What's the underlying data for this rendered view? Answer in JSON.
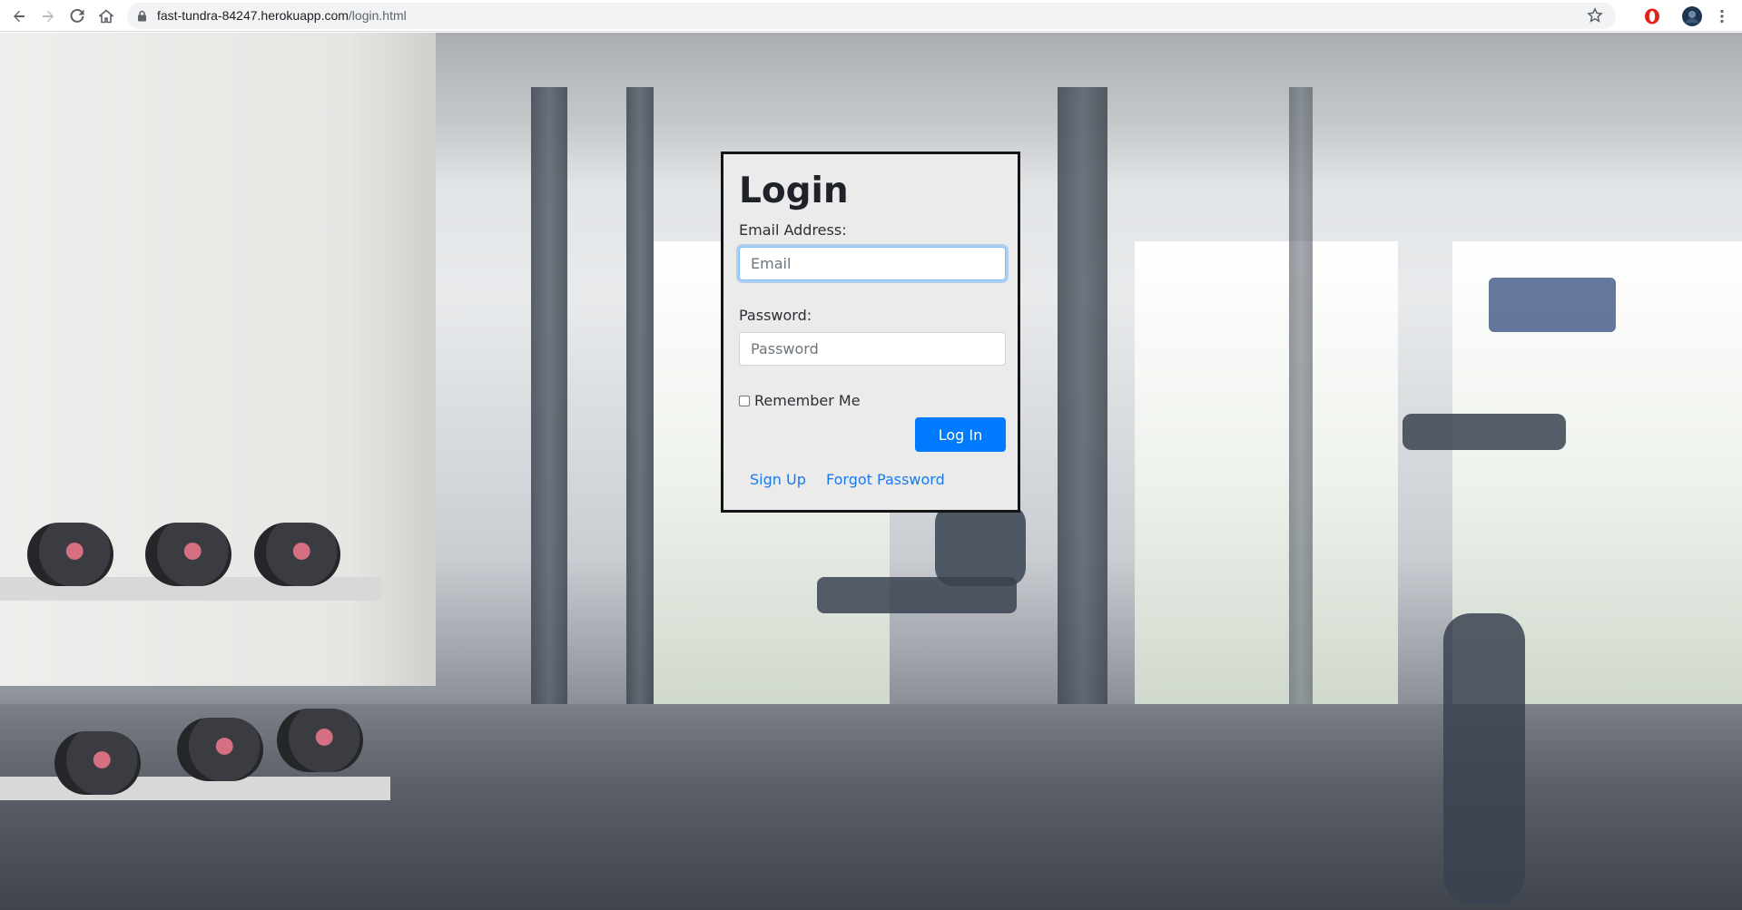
{
  "browser": {
    "url_host": "fast-tundra-84247.herokuapp.com",
    "url_path": "/login.html",
    "icons": [
      "back-icon",
      "forward-icon",
      "reload-icon",
      "home-icon",
      "lock-icon",
      "star-icon",
      "opera-icon",
      "avatar",
      "menu-icon"
    ]
  },
  "login": {
    "title": "Login",
    "email_label": "Email Address:",
    "email_placeholder": "Email",
    "email_value": "",
    "password_label": "Password:",
    "password_placeholder": "Password",
    "password_value": "",
    "remember_label": "Remember Me",
    "remember_checked": false,
    "submit_label": "Log In",
    "signup_link": "Sign Up",
    "forgot_link": "Forgot Password"
  },
  "colors": {
    "primary": "#007bff",
    "link": "#1a7ae8",
    "card_bg": "#ebebeb",
    "card_border": "#151515"
  }
}
